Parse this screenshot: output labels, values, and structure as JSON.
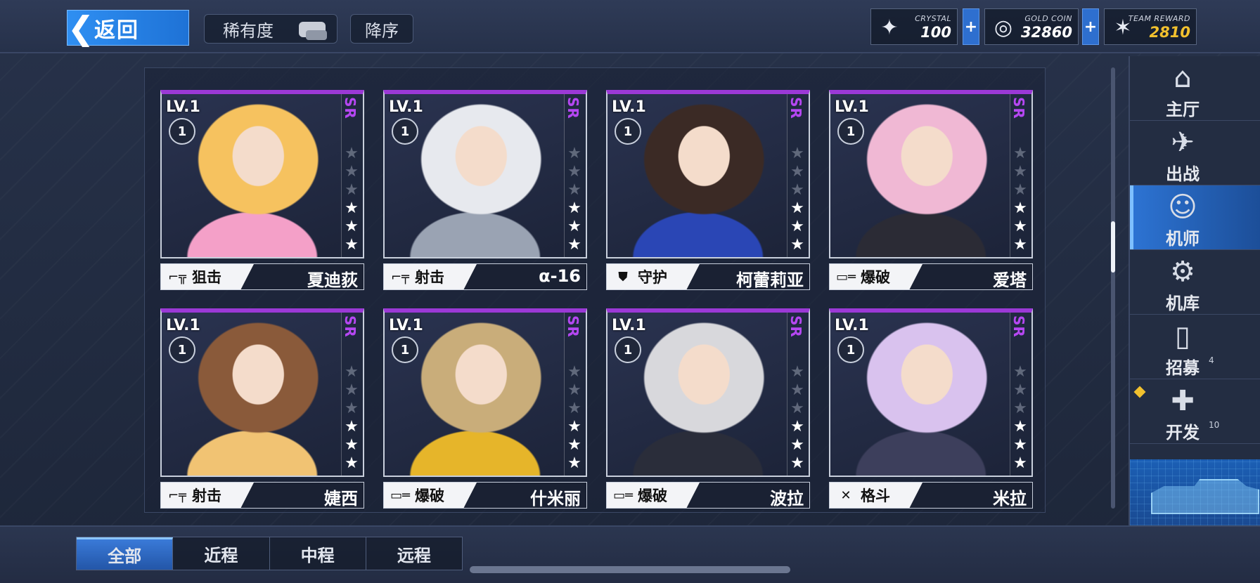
{
  "header": {
    "back_label": "返回",
    "rarity_label": "稀有度",
    "sort_label": "降序"
  },
  "resources": {
    "crystal": {
      "name": "CRYSTAL",
      "value": "100"
    },
    "gold": {
      "name": "GOLD COIN",
      "value": "32860"
    },
    "team": {
      "name": "TEAM REWARD",
      "value": "2810"
    },
    "plus_symbol": "+"
  },
  "cards": [
    {
      "level": "LV.1",
      "badge": "1",
      "rarity": "SR",
      "role": "狙击",
      "role_icon": "sniper-rifle-icon",
      "name": "夏迪荻",
      "stars": 3,
      "colors": [
        "#f6c25f",
        "#f4a0c8"
      ]
    },
    {
      "level": "LV.1",
      "badge": "1",
      "rarity": "SR",
      "role": "射击",
      "role_icon": "rifle-icon",
      "name": "α-16",
      "stars": 3,
      "colors": [
        "#e7e9ee",
        "#9aa3b3"
      ]
    },
    {
      "level": "LV.1",
      "badge": "1",
      "rarity": "SR",
      "role": "守护",
      "role_icon": "shield-icon",
      "name": "柯蕾莉亚",
      "stars": 3,
      "colors": [
        "#3b2a25",
        "#2a46b5"
      ]
    },
    {
      "level": "LV.1",
      "badge": "1",
      "rarity": "SR",
      "role": "爆破",
      "role_icon": "launcher-icon",
      "name": "爱塔",
      "stars": 3,
      "colors": [
        "#f0b8d4",
        "#2b2b35"
      ]
    },
    {
      "level": "LV.1",
      "badge": "1",
      "rarity": "SR",
      "role": "射击",
      "role_icon": "rifle-icon",
      "name": "婕西",
      "stars": 3,
      "colors": [
        "#8a5a3a",
        "#f1c373"
      ]
    },
    {
      "level": "LV.1",
      "badge": "1",
      "rarity": "SR",
      "role": "爆破",
      "role_icon": "launcher-icon",
      "name": "什米丽",
      "stars": 3,
      "colors": [
        "#c9ad7a",
        "#e6b52a"
      ]
    },
    {
      "level": "LV.1",
      "badge": "1",
      "rarity": "SR",
      "role": "爆破",
      "role_icon": "launcher-icon",
      "name": "波拉",
      "stars": 3,
      "colors": [
        "#d8d8dc",
        "#2a2d3a"
      ]
    },
    {
      "level": "LV.1",
      "badge": "1",
      "rarity": "SR",
      "role": "格斗",
      "role_icon": "crossed-swords-icon",
      "name": "米拉",
      "stars": 3,
      "colors": [
        "#d9c2ee",
        "#3d3f5c"
      ]
    }
  ],
  "nav": [
    {
      "label": "主厅",
      "icon": "lobby-icon",
      "active": false
    },
    {
      "label": "出战",
      "icon": "sortie-icon",
      "active": false
    },
    {
      "label": "机师",
      "icon": "pilot-icon",
      "active": true
    },
    {
      "label": "机库",
      "icon": "hangar-icon",
      "active": false
    },
    {
      "label": "招募",
      "icon": "recruit-card-icon",
      "active": false,
      "badge": "4"
    },
    {
      "label": "开发",
      "icon": "wrench-icon",
      "active": false,
      "badge": "10"
    }
  ],
  "tabs": [
    "全部",
    "近程",
    "中程",
    "远程"
  ],
  "active_tab": 0
}
